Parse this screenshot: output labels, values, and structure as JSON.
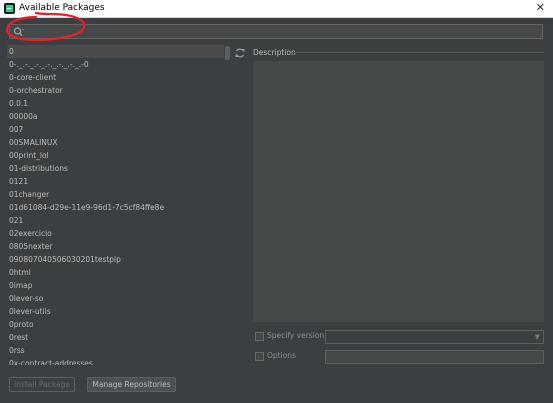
{
  "window": {
    "title": "Available Packages",
    "close_glyph": "✕"
  },
  "search": {
    "value": "",
    "placeholder": ""
  },
  "packages": [
    "0",
    "0-._.-._.-._.-._.-._.-._.-0",
    "0-core-client",
    "0-orchestrator",
    "0.0.1",
    "00000a",
    "007",
    "00SMALINUX",
    "00print_lol",
    "01-distributions",
    "0121",
    "01changer",
    "01d61084-d29e-11e9-96d1-7c5cf84ffe8e",
    "021",
    "02exercicio",
    "0805nexter",
    "090807040506030201testpip",
    "0html",
    "0imap",
    "0lever-so",
    "0lever-utils",
    "0proto",
    "0rest",
    "0rss",
    "0x-contract-addresses"
  ],
  "description": {
    "label": "Description"
  },
  "options": {
    "specify_version_label": "Specify version",
    "options_label": "Options"
  },
  "buttons": {
    "install": "Install Package",
    "manage": "Manage Repositories"
  },
  "colors": {
    "annotation": "#e8202a",
    "background": "#3c3f41",
    "selected_row": "#4b4b4b"
  },
  "icons": {
    "search": "search-icon",
    "refresh": "refresh-icon",
    "app": "pycharm-app-icon"
  }
}
